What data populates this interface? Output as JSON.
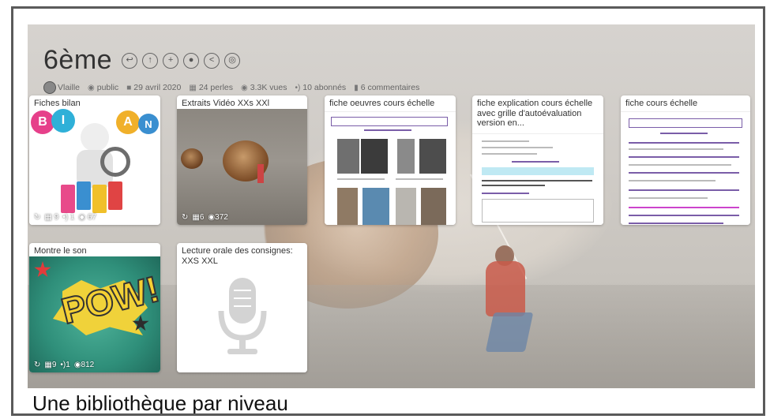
{
  "header": {
    "title": "6ème",
    "actions": [
      "back-icon",
      "up-icon",
      "subscribe-icon",
      "members-icon",
      "share-icon",
      "target-icon"
    ]
  },
  "meta": {
    "author": "Vlaille",
    "visibility": "public",
    "date": "29 avril 2020",
    "perles": "24 perles",
    "views": "3.3K vues",
    "subscribers": "10 abonnés",
    "comments": "6 commentaires"
  },
  "cards": [
    {
      "title": "Fiches bilan",
      "stats": {
        "pearls": "9",
        "subs": "1",
        "views": "67"
      }
    },
    {
      "title": "Extraits Vidéo XXs XXl",
      "stats": {
        "pearls": "6",
        "views": "372"
      }
    },
    {
      "title": "fiche oeuvres cours échelle"
    },
    {
      "title": "fiche explication cours échelle avec grille d'autoévaluation version en..."
    },
    {
      "title": "fiche cours échelle"
    },
    {
      "title": "Montre le son",
      "stats": {
        "pearls": "9",
        "subs": "1",
        "views": "812"
      }
    },
    {
      "title": "Lecture orale des consignes: XXS XXL"
    }
  ],
  "caption": "Une bibliothèque par niveau",
  "colors": {
    "accent": "#7a5da8",
    "pow_bg": "#2f8f7a",
    "pow_text": "#f5d033"
  }
}
